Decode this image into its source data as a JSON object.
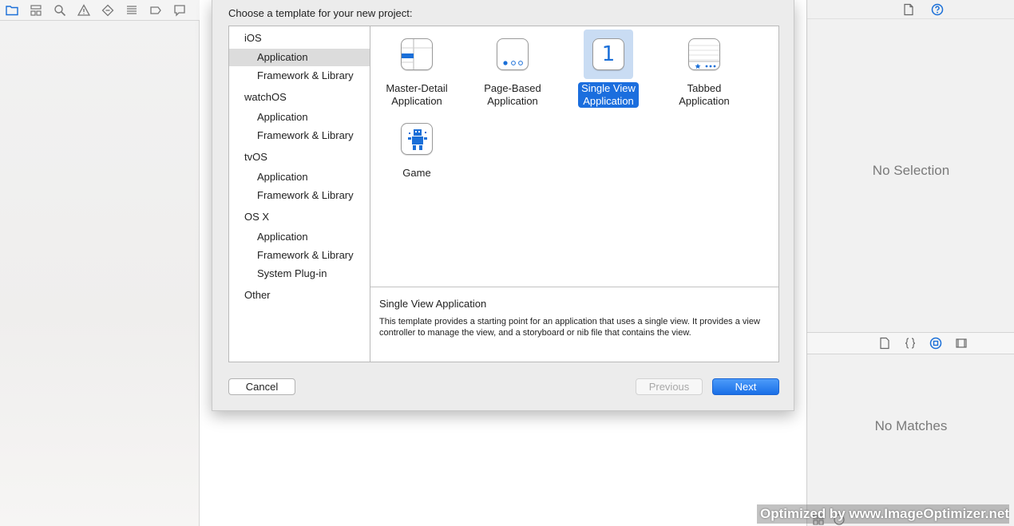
{
  "dialog": {
    "title": "Choose a template for your new project:",
    "platforms": [
      {
        "label": "iOS",
        "items": [
          "Application",
          "Framework & Library"
        ]
      },
      {
        "label": "watchOS",
        "items": [
          "Application",
          "Framework & Library"
        ]
      },
      {
        "label": "tvOS",
        "items": [
          "Application",
          "Framework & Library"
        ]
      },
      {
        "label": "OS X",
        "items": [
          "Application",
          "Framework & Library",
          "System Plug-in"
        ]
      },
      {
        "label": "Other",
        "items": []
      }
    ],
    "selected_platform_item": "iOS / Application",
    "templates": [
      {
        "line1": "Master-Detail",
        "line2": "Application",
        "icon": "master-detail-icon"
      },
      {
        "line1": "Page-Based",
        "line2": "Application",
        "icon": "page-based-icon"
      },
      {
        "line1": "Single View",
        "line2": "Application",
        "icon": "single-view-icon",
        "icon_text": "1"
      },
      {
        "line1": "Tabbed",
        "line2": "Application",
        "icon": "tabbed-icon"
      },
      {
        "line1": "Game",
        "line2": "",
        "icon": "game-icon"
      }
    ],
    "selected_template": "Single View Application",
    "description": {
      "title": "Single View Application",
      "body": "This template provides a starting point for an application that uses a single view. It provides a view controller to manage the view, and a storyboard or nib file that contains the view."
    },
    "buttons": {
      "cancel": "Cancel",
      "previous": "Previous",
      "next": "Next"
    }
  },
  "inspector": {
    "no_selection": "No Selection",
    "no_matches": "No Matches"
  },
  "watermark": "Optimized by www.ImageOptimizer.net",
  "colors": {
    "accent": "#1b6ede",
    "selection_bg": "#c9dcf3",
    "toolbar_icon": "#1a6fd8"
  }
}
